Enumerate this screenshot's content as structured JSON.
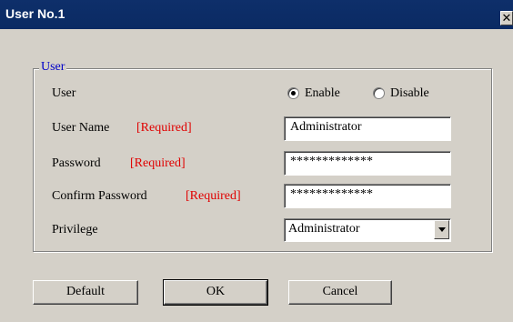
{
  "window": {
    "title": "User No.1",
    "close_glyph": "✕"
  },
  "group": {
    "legend": "User"
  },
  "rows": {
    "user_label": "User",
    "enable_label": "Enable",
    "disable_label": "Disable",
    "enable_selected": true,
    "user_name_label": "User Name",
    "password_label": "Password",
    "confirm_password_label": "Confirm Password",
    "privilege_label": "Privilege",
    "required_tag": "[Required]"
  },
  "fields": {
    "user_name_value": "Administrator",
    "password_value": "*************",
    "confirm_password_value": "*************",
    "privilege_value": "Administrator"
  },
  "buttons": {
    "default": "Default",
    "ok": "OK",
    "cancel": "Cancel"
  },
  "colors": {
    "title_bar": "#0a2a63",
    "required": "#e00000",
    "legend": "#0000c8",
    "dialog_bg": "#d4d0c8"
  }
}
